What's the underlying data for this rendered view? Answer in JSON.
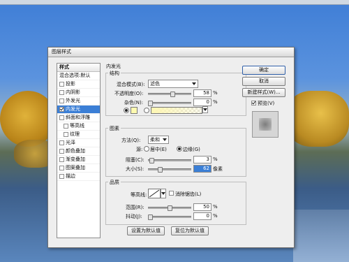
{
  "dialog": {
    "title": "图层样式"
  },
  "style_list": {
    "header": "样式",
    "items": [
      {
        "label": "混合选项:默认",
        "checkbox": false,
        "checked": false,
        "indent": false,
        "selected": false
      },
      {
        "label": "投影",
        "checkbox": true,
        "checked": false,
        "indent": false,
        "selected": false
      },
      {
        "label": "内阴影",
        "checkbox": true,
        "checked": false,
        "indent": false,
        "selected": false
      },
      {
        "label": "外发光",
        "checkbox": true,
        "checked": false,
        "indent": false,
        "selected": false
      },
      {
        "label": "内发光",
        "checkbox": true,
        "checked": true,
        "indent": false,
        "selected": true
      },
      {
        "label": "斜面和浮雕",
        "checkbox": true,
        "checked": false,
        "indent": false,
        "selected": false
      },
      {
        "label": "等高线",
        "checkbox": true,
        "checked": false,
        "indent": true,
        "selected": false
      },
      {
        "label": "纹理",
        "checkbox": true,
        "checked": false,
        "indent": true,
        "selected": false
      },
      {
        "label": "光泽",
        "checkbox": true,
        "checked": false,
        "indent": false,
        "selected": false
      },
      {
        "label": "颜色叠加",
        "checkbox": true,
        "checked": false,
        "indent": false,
        "selected": false
      },
      {
        "label": "渐变叠加",
        "checkbox": true,
        "checked": false,
        "indent": false,
        "selected": false
      },
      {
        "label": "图案叠加",
        "checkbox": true,
        "checked": false,
        "indent": false,
        "selected": false
      },
      {
        "label": "描边",
        "checkbox": true,
        "checked": false,
        "indent": false,
        "selected": false
      }
    ]
  },
  "panel": {
    "section_title": "内发光",
    "structure": {
      "title": "结构",
      "blend_mode_label": "混合模式(B):",
      "blend_mode_value": "滤色",
      "opacity_label": "不透明度(O):",
      "opacity_value": "58",
      "noise_label": "杂色(N):",
      "noise_value": "0",
      "percent": "%"
    },
    "elements": {
      "title": "图素",
      "method_label": "方法(Q):",
      "method_value": "柔和",
      "source_label": "源:",
      "source_center": "居中(E)",
      "source_edge": "边缘(G)",
      "choke_label": "阻塞(C):",
      "choke_value": "3",
      "size_label": "大小(S):",
      "size_value": "62",
      "percent": "%",
      "pixels": "像素"
    },
    "quality": {
      "title": "品质",
      "contour_label": "等高线:",
      "anti_alias_label": "消除锯齿(L)",
      "range_label": "范围(R):",
      "range_value": "50",
      "jitter_label": "抖动(J):",
      "jitter_value": "0",
      "percent": "%"
    },
    "make_default": "设置为默认值",
    "reset_default": "复位为默认值"
  },
  "buttons": {
    "ok": "确定",
    "cancel": "取消",
    "new_style": "新建样式(W)...",
    "preview_label": "预览(V)"
  },
  "colors": {
    "glow_color": "#fffab0",
    "selection": "#3b7fd6"
  }
}
